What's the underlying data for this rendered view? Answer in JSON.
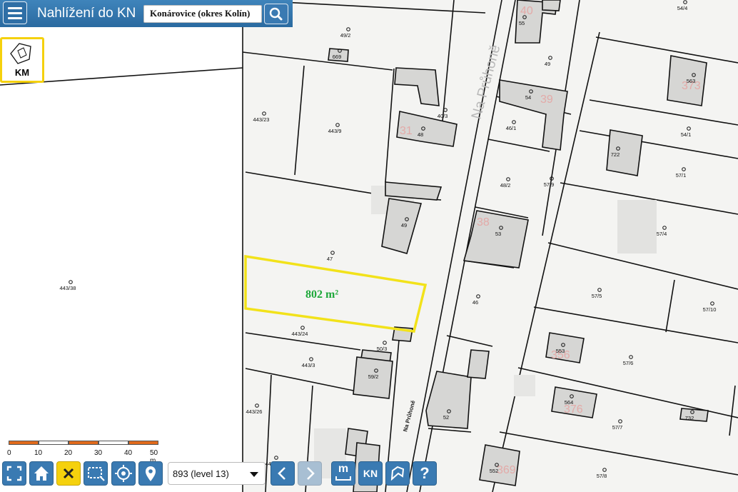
{
  "app": {
    "title": "Nahlížení do KN"
  },
  "search": {
    "value": "Konárovice (okres Kolín)"
  },
  "layer_toggle": {
    "label": "KM"
  },
  "map": {
    "street_name": "Na Průhoně",
    "street_label_small": "Na Průhoně",
    "selection_area": "802 m²",
    "accent_color": "#f2e21a",
    "area_text_color": "#1ea83a",
    "house_numbers": [
      "40",
      "39",
      "373",
      "31",
      "38",
      "356",
      "376",
      "369"
    ],
    "parcels": [
      "49/2",
      "54/4",
      "669",
      "55",
      "49",
      "563",
      "443/23",
      "443/9",
      "40/3",
      "54",
      "48",
      "46/1",
      "54/1",
      "722",
      "48/2",
      "57/9",
      "57/1",
      "49",
      "53",
      "57/4",
      "47",
      "443/38",
      "46",
      "57/5",
      "57/10",
      "443/24",
      "50/3",
      "553",
      "57/6",
      "443/3",
      "59/2",
      "564",
      "732",
      "443/26",
      "52",
      "57/7",
      "443/27",
      "552",
      "57/8"
    ]
  },
  "scale": {
    "ticks": [
      "0",
      "10",
      "20",
      "30",
      "40",
      "50 m"
    ]
  },
  "toolbar": {
    "level_value": "893 (level 13)",
    "kn_label": "KN",
    "measure_label": "m",
    "help_label": "?"
  }
}
